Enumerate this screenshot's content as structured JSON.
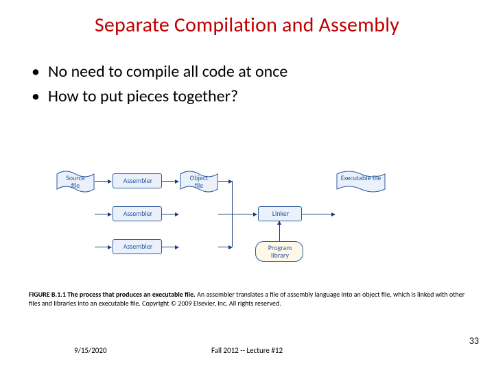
{
  "title": "Separate Compilation and Assembly",
  "bullets": [
    "No need to compile all code at once",
    "How to put pieces together?"
  ],
  "diagram": {
    "source_label": "Source\nfile",
    "assembler_label": "Assembler",
    "object_label": "Object\nfile",
    "linker_label": "Linker",
    "program_library_label": "Program\nlibrary",
    "executable_label": "Executable\nfile"
  },
  "caption": {
    "bold": "FIGURE B.1.1 The process that produces an executable file.",
    "rest": " An assembler translates a file of assembly language into an object file, which is linked with other files and libraries into an executable file. Copyright © 2009 Elsevier, Inc. All rights reserved."
  },
  "footer": {
    "date": "9/15/2020",
    "center": "Fall 2012 -- Lecture #12",
    "page": "33"
  }
}
